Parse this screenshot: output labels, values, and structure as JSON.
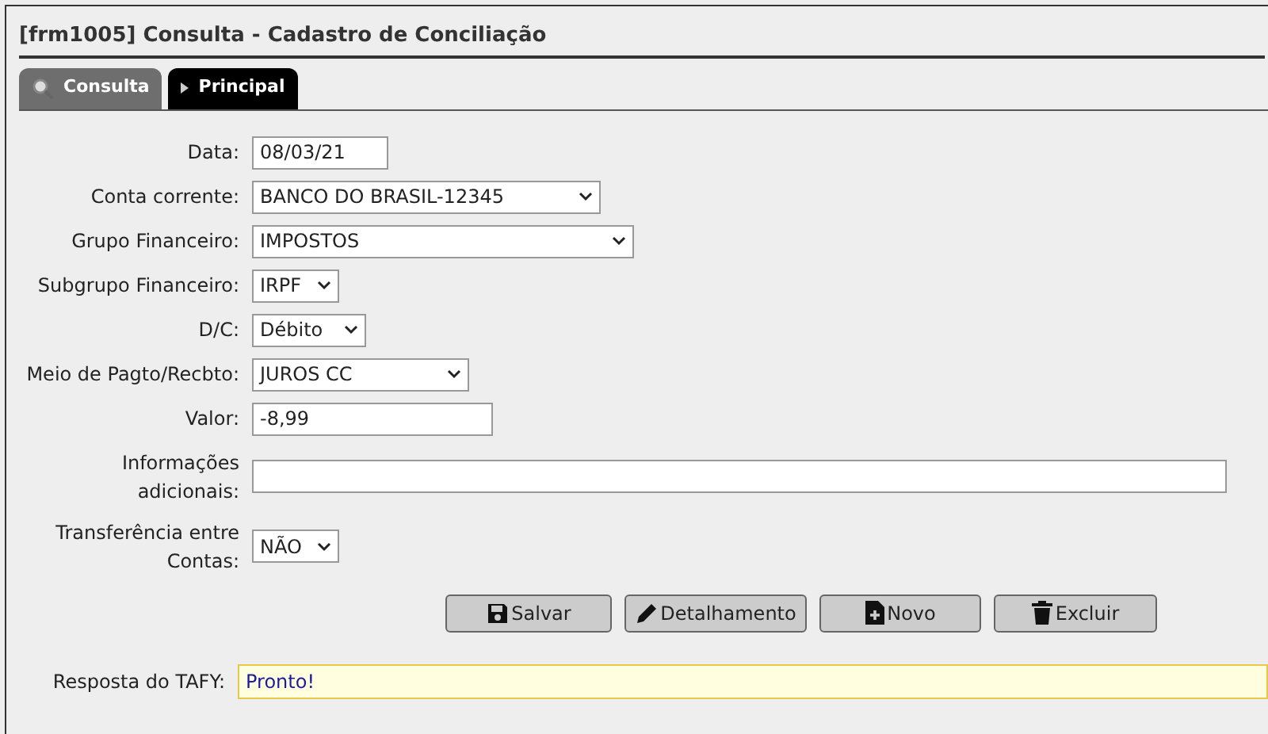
{
  "window": {
    "title": "[frm1005] Consulta - Cadastro de Conciliação"
  },
  "tabs": [
    {
      "label": "Consulta",
      "selected": false
    },
    {
      "label": "Principal",
      "selected": true
    }
  ],
  "fields": [
    {
      "kind": "text",
      "label": "Data:",
      "value": "08/03/21"
    },
    {
      "kind": "select",
      "label": "Conta corrente:",
      "value": "BANCO DO BRASIL-12345"
    },
    {
      "kind": "select",
      "label": "Grupo Financeiro:",
      "value": "IMPOSTOS"
    },
    {
      "kind": "select",
      "label": "Subgrupo Financeiro:",
      "value": "IRPF"
    },
    {
      "kind": "select",
      "label": "D/C:",
      "value": "Débito"
    },
    {
      "kind": "select",
      "label": "Meio de Pagto/Recbto:",
      "value": "JUROS CC"
    },
    {
      "kind": "text",
      "label": "Valor:",
      "value": "-8,99"
    },
    {
      "kind": "text",
      "label": "Informações adicionais:"
    },
    {
      "kind": "select",
      "label": "Transferência entre Contas:",
      "value": "NÃO"
    }
  ],
  "buttons": [
    {
      "label": "Salvar"
    },
    {
      "label": "Detalhamento"
    },
    {
      "label": "Novo"
    },
    {
      "label": "Excluir"
    }
  ],
  "response": {
    "label": "Resposta do TAFY:",
    "value": "Pronto!"
  }
}
